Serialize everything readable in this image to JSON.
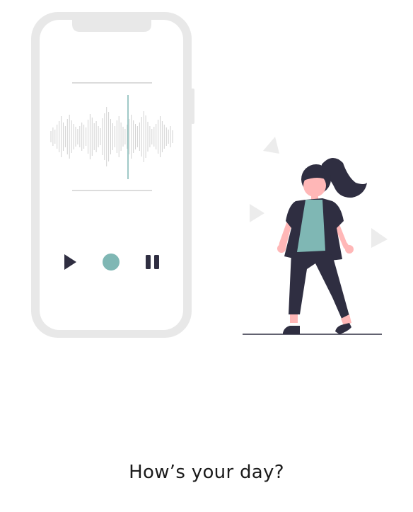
{
  "prompt": {
    "text": "How’s your day?"
  },
  "icons": {
    "play": "play-icon",
    "record": "record-icon",
    "pause": "pause-icon"
  },
  "colors": {
    "accent": "#7fb7b4",
    "dark": "#2f2e41",
    "skin": "#ffb7b7",
    "frame": "#e8e8e8",
    "text": "#1b1b1b"
  }
}
